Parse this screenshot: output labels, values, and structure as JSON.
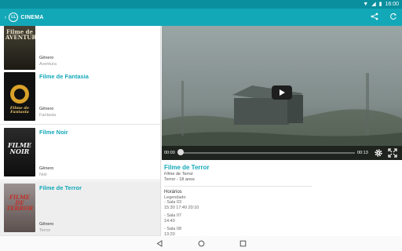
{
  "status_bar": {
    "time": "16:00"
  },
  "app_bar": {
    "logo_badge": "LL",
    "title": "CINEMA",
    "share_icon": "share-icon",
    "refresh_icon": "refresh-icon"
  },
  "movies": [
    {
      "title": "",
      "genre_label": "Gênero",
      "genre": "Aventura",
      "poster_text": "Filme de AVENTURA",
      "poster_color": "#2d2a1f"
    },
    {
      "title": "Filme de Fantasia",
      "genre_label": "Gênero",
      "genre": "Fantasia",
      "poster_text": "Filme de Fantasia",
      "poster_color": "#121212"
    },
    {
      "title": "Filme Noir",
      "genre_label": "Gênero",
      "genre": "Noir",
      "poster_text": "FILME NOIR",
      "poster_color": "#1a1a1a"
    },
    {
      "title": "Filme de Terror",
      "genre_label": "Gênero",
      "genre": "Terror",
      "poster_text": "FILME DE TERROR",
      "poster_color": "#7a6d6a"
    }
  ],
  "player": {
    "current_time": "00:00",
    "total_time": "00:13",
    "progress": 0.0
  },
  "detail": {
    "title": "Filme de Terror",
    "original_title": "Filme de Terror",
    "meta": "Terror - 18 anos",
    "schedule_heading": "Horários",
    "schedule_sub": "Legendado",
    "rooms": [
      {
        "room": "- Sala 03",
        "times": "15:30 17:40 20:10"
      },
      {
        "room": "- Sala 07",
        "times": "14:40"
      },
      {
        "room": "- Sala 08",
        "times": "13:20"
      }
    ]
  },
  "colors": {
    "accent": "#13a8b8",
    "status_bar": "#0a8f9e"
  }
}
